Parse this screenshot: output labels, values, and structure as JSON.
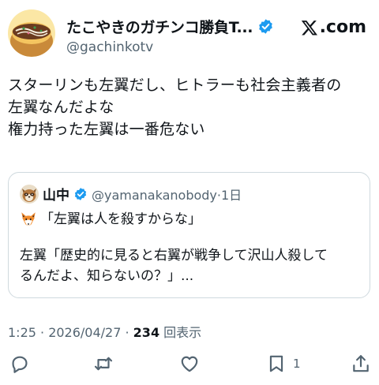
{
  "author": {
    "display_name": "たこやきのガチンコ勝負T...",
    "handle": "@gachinkotv",
    "avatar_icon": "takoyaki-avatar-icon",
    "verified_icon": "verified-badge-icon"
  },
  "brand": {
    "logo_icon": "x-logo-icon",
    "text": ".com"
  },
  "tweet": {
    "lines": [
      "スターリンも左翼だし、ヒトラーも社会主義者の",
      "左翼なんだよな",
      "権力持った左翼は一番危ない"
    ]
  },
  "quote": {
    "display_name": "山中",
    "handle_time": "@yamanakanobody·1日",
    "avatar_icon": "raccoon-dog-avatar-icon",
    "line1_icon": "fox-emoji-icon",
    "line1": "「左翼は人を殺すからな」",
    "line2": "左翼「歴史的に見ると右翼が戦争して沢山人殺して",
    "line3": "るんだよ、知らないの？」..."
  },
  "meta": {
    "time_date": "1:25 · 2026/04/27 · ",
    "views_count": "234",
    "views_label": " 回表示"
  },
  "actions": {
    "reply_icon": "reply-icon",
    "retweet_icon": "retweet-icon",
    "like_icon": "heart-icon",
    "bookmark_icon": "bookmark-icon",
    "bookmark_count": "1",
    "share_icon": "share-icon"
  },
  "colors": {
    "verified": "#1d9bf0",
    "secondary_text": "#536471",
    "border": "#cfd9de"
  }
}
